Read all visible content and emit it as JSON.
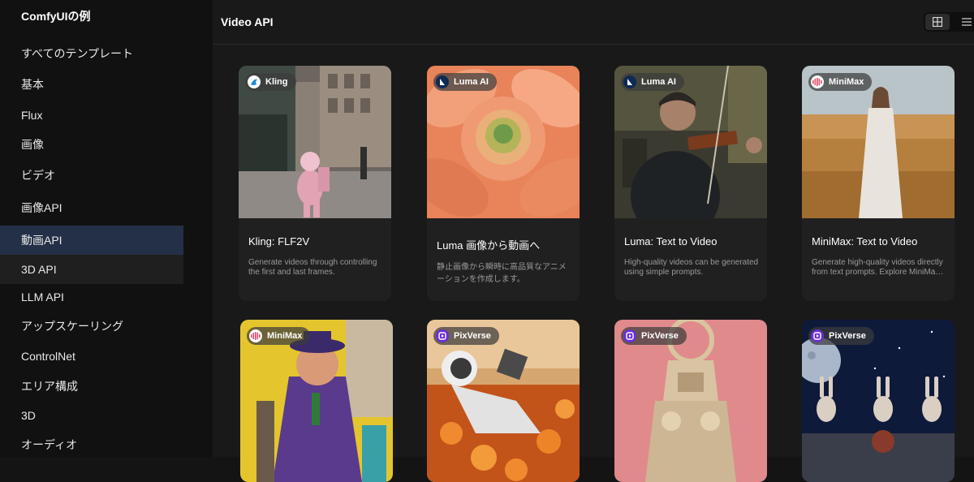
{
  "sidebar": {
    "brand": "ComfyUIの例",
    "items": [
      {
        "label": "すべてのテンプレート"
      },
      {
        "label": "基本"
      },
      {
        "label": "Flux"
      },
      {
        "label": "画像"
      },
      {
        "label": "ビデオ"
      },
      {
        "label": "画像API"
      },
      {
        "label": "動画API"
      },
      {
        "label": "3D API"
      },
      {
        "label": "LLM API"
      },
      {
        "label": "アップスケーリング"
      },
      {
        "label": "ControlNet"
      },
      {
        "label": "エリア構成"
      },
      {
        "label": "3D"
      },
      {
        "label": "オーディオ"
      }
    ],
    "active_item": "動画API"
  },
  "header": {
    "title": "Video API",
    "view_modes": [
      {
        "icon": "grid-view-icon",
        "selected": true
      },
      {
        "icon": "list-view-icon",
        "selected": false
      }
    ]
  },
  "cards": [
    {
      "provider": "Kling",
      "provider_icon": "kling-logo-icon",
      "title": "Kling: FLF2V",
      "description": "Generate videos through controlling the first and last frames."
    },
    {
      "provider": "Luma AI",
      "provider_icon": "luma-logo-icon",
      "title": "Luma 画像から動画へ",
      "description": "静止画像から瞬時に高品質なアニメーションを作成します。"
    },
    {
      "provider": "Luma AI",
      "provider_icon": "luma-logo-icon",
      "title": "Luma: Text to Video",
      "description": "High-quality videos can be generated using simple prompts."
    },
    {
      "provider": "MiniMax",
      "provider_icon": "minimax-logo-icon",
      "title": "MiniMax: Text to Video",
      "description": "Generate high-quality videos directly from text prompts. Explore MiniMax's advanced AI capabilities."
    },
    {
      "provider": "MiniMax",
      "provider_icon": "minimax-logo-icon",
      "title": "",
      "description": ""
    },
    {
      "provider": "PixVerse",
      "provider_icon": "pixverse-logo-icon",
      "title": "",
      "description": ""
    },
    {
      "provider": "PixVerse",
      "provider_icon": "pixverse-logo-icon",
      "title": "",
      "description": ""
    },
    {
      "provider": "PixVerse",
      "provider_icon": "pixverse-logo-icon",
      "title": "",
      "description": ""
    }
  ]
}
